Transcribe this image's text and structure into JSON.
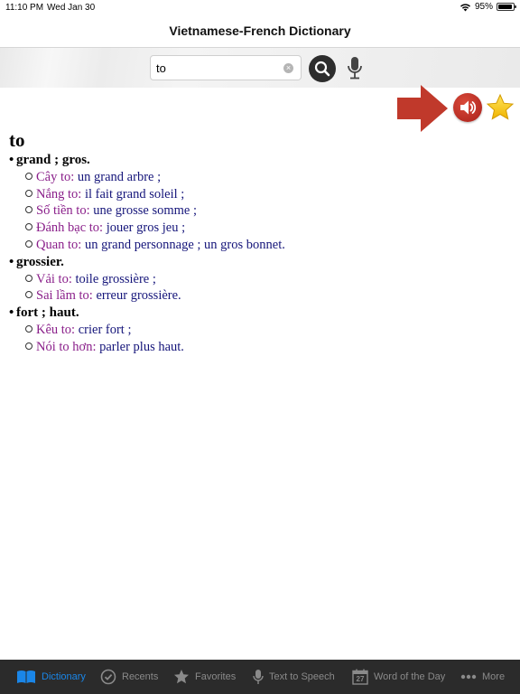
{
  "status_bar": {
    "time": "11:10 PM",
    "date": "Wed Jan 30",
    "battery_text": "95%",
    "battery_level": 0.95
  },
  "nav": {
    "title": "Vietnamese-French Dictionary"
  },
  "search": {
    "value": "to",
    "placeholder": ""
  },
  "entry": {
    "headword": "to",
    "senses": [
      {
        "title": "grand ; gros.",
        "examples": [
          {
            "vi": "Cây to:",
            "fr": " un grand arbre ;"
          },
          {
            "vi": "Nắng to:",
            "fr": " il fait grand soleil ;"
          },
          {
            "vi": "Số tiền to:",
            "fr": " une grosse somme ;"
          },
          {
            "vi": "Đánh bạc to:",
            "fr": " jouer gros jeu ;"
          },
          {
            "vi": "Quan to:",
            "fr": " un grand personnage ; un gros bonnet."
          }
        ]
      },
      {
        "title": "grossier.",
        "examples": [
          {
            "vi": "Vải to:",
            "fr": " toile grossière ;"
          },
          {
            "vi": "Sai lầm to:",
            "fr": " erreur grossière."
          }
        ]
      },
      {
        "title": "fort ; haut.",
        "examples": [
          {
            "vi": "Kêu to:",
            "fr": " crier fort ;"
          },
          {
            "vi": "Nói to hơn:",
            "fr": " parler plus haut."
          }
        ]
      }
    ]
  },
  "tabs": [
    {
      "label": "Dictionary",
      "icon": "book-icon",
      "active": true
    },
    {
      "label": "Recents",
      "icon": "check-circle-icon",
      "active": false
    },
    {
      "label": "Favorites",
      "icon": "star-icon",
      "active": false
    },
    {
      "label": "Text to Speech",
      "icon": "microphone-icon",
      "active": false
    },
    {
      "label": "Word of the Day",
      "icon": "calendar-icon",
      "active": false,
      "badge": "27"
    },
    {
      "label": "More",
      "icon": "more-dots-icon",
      "active": false
    }
  ],
  "colors": {
    "accent": "#1a86e8",
    "vietnamese_text": "#8a1f8a",
    "french_text": "#15157a",
    "speaker": "#b82a20",
    "arrow": "#c0392b",
    "star": "#f5c518"
  }
}
